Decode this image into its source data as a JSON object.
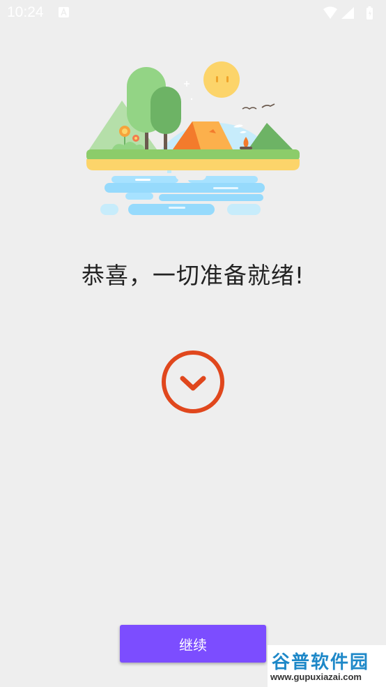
{
  "status_bar": {
    "time": "10:24",
    "icons": [
      "notification-a-icon",
      "wifi-icon",
      "signal-icon",
      "battery-icon"
    ]
  },
  "illustration": {
    "icon": "camping-landscape-illustration"
  },
  "headline": "恭喜，一切准备就绪!",
  "success_icon": "check-circle-icon",
  "continue_label": "继续",
  "colors": {
    "background": "#eeeeee",
    "accent_button": "#7c4dff",
    "success": "#e0471d"
  },
  "watermark": {
    "logo": "谷普软件园",
    "url": "www.gupuxiazai.com"
  }
}
